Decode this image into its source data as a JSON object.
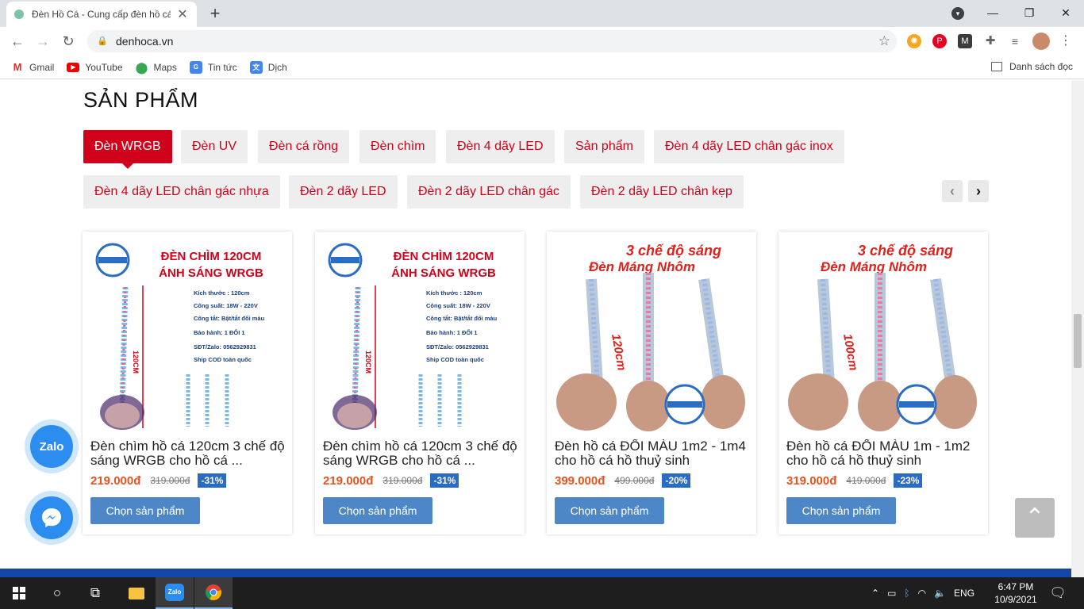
{
  "browser": {
    "tab_title": "Đèn Hồ Cá - Cung cấp đèn hồ cá",
    "url": "denhoca.vn",
    "bookmarks": [
      "Gmail",
      "YouTube",
      "Maps",
      "Tin tức",
      "Dịch"
    ],
    "reading_list": "Danh sách đọc"
  },
  "section": {
    "title": "SẢN PHẨM"
  },
  "categories": [
    "Đèn WRGB",
    "Đèn UV",
    "Đèn cá rồng",
    "Đèn chìm",
    "Đèn 4 dãy LED",
    "Sản phẩm",
    "Đèn 4 dãy LED chân gác inox",
    "Đèn 4 dãy LED chân gác nhựa",
    "Đèn 2 dãy LED",
    "Đèn 2 dãy LED chân gác",
    "Đèn 2 dãy LED chân kẹp"
  ],
  "products": [
    {
      "name": "Đèn chìm hồ cá 120cm 3 chế độ sáng WRGB cho hồ cá ...",
      "price": "219.000đ",
      "old_price": "319.000đ",
      "discount": "-31%",
      "button": "Chọn sản phẩm",
      "img": {
        "headline1": "ĐÈN CHÌM 120CM",
        "headline2": "ÁNH SÁNG WRGB",
        "size_label": "120CM",
        "specs": [
          "Kích thước : 120cm",
          "Công suất: 18W - 220V",
          "Công tắt: Bật/tắt đổi màu",
          "Bảo hành: 1 ĐỔI 1",
          "SĐT/Zalo: 0562929831",
          "Ship COD toàn quốc"
        ]
      }
    },
    {
      "name": "Đèn chìm hồ cá 120cm 3 chế độ sáng WRGB cho hồ cá ...",
      "price": "219.000đ",
      "old_price": "319.000đ",
      "discount": "-31%",
      "button": "Chọn sản phẩm",
      "img": {
        "headline1": "ĐÈN CHÌM 120CM",
        "headline2": "ÁNH SÁNG WRGB",
        "size_label": "120CM",
        "specs": [
          "Kích thước : 120cm",
          "Công suất: 18W - 220V",
          "Công tắt: Bật/tắt đổi màu",
          "Bảo hành: 1 ĐỔI 1",
          "SĐT/Zalo: 0562929831",
          "Ship COD toàn quốc"
        ]
      }
    },
    {
      "name": "Đèn hồ cá ĐỔI MÀU 1m2 - 1m4 cho hồ cá hồ thuỷ sinh",
      "price": "399.000đ",
      "old_price": "499.000đ",
      "discount": "-20%",
      "button": "Chọn sản phẩm",
      "img": {
        "headline1": "3 chế độ sáng",
        "headline2": "Đèn Máng Nhôm",
        "size_label": "120cm"
      }
    },
    {
      "name": "Đèn hồ cá ĐỔI MÀU 1m - 1m2 cho hồ cá hồ thuỷ sinh",
      "price": "319.000đ",
      "old_price": "419.000đ",
      "discount": "-23%",
      "button": "Chọn sản phẩm",
      "img": {
        "headline1": "3 chế độ sáng",
        "headline2": "Đèn Máng Nhôm",
        "size_label": "100cm"
      }
    }
  ],
  "floating": {
    "zalo": "Zalo"
  },
  "taskbar": {
    "lang": "ENG",
    "time": "6:47 PM",
    "date": "10/9/2021"
  },
  "colors": {
    "accent": "#d0011b",
    "button": "#4e87c8",
    "price": "#e8521f",
    "badge": "#2a6bc4"
  }
}
